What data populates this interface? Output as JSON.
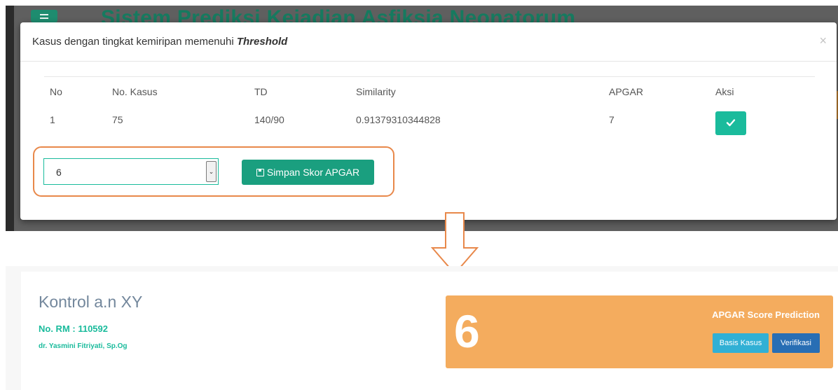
{
  "background_app": {
    "title": "Sistem Prediksi Kejadian Asfiksia Neonatorum"
  },
  "modal": {
    "title_prefix": "Kasus dengan tingkat kemiripan memenuhi",
    "title_emphasis": "Threshold",
    "close_label": "×",
    "table": {
      "headers": [
        "No",
        "No. Kasus",
        "TD",
        "Similarity",
        "APGAR",
        "Aksi"
      ],
      "rows": [
        {
          "no": "1",
          "kasus": "75",
          "td": "140/90",
          "similarity": "0.91379310344828",
          "apgar": "7",
          "action_icon": "check-icon"
        }
      ]
    },
    "apgar_select": {
      "selected": "6"
    },
    "save_button": "Simpan Skor APGAR"
  },
  "patient": {
    "name": "Kontrol a.n XY",
    "rm": "No. RM : 110592",
    "doctor": "dr. Yasmini Fitriyati, Sp.Og"
  },
  "prediction": {
    "score": "6",
    "label": "APGAR Score Prediction",
    "basis_button": "Basis Kasus",
    "verify_button": "Verifikasi"
  },
  "colors": {
    "accent_green": "#1abb9c",
    "highlight_orange": "#e8884a",
    "score_card": "#f4ac5e",
    "info_button": "#31b0d5",
    "primary_button": "#286eb4"
  }
}
